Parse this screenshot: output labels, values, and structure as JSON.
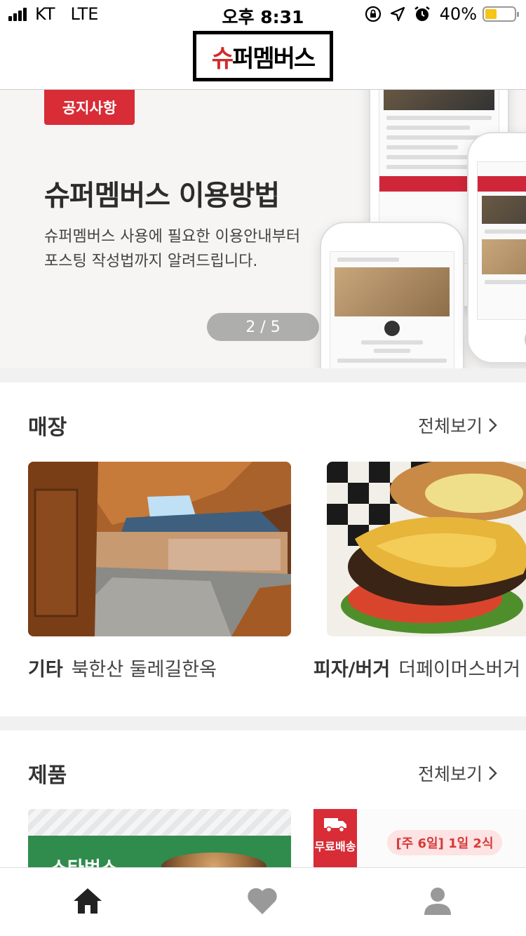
{
  "status_bar": {
    "carrier": "KT",
    "network": "LTE",
    "time": "오후 8:31",
    "battery_percent": "40%",
    "battery_level": 0.4,
    "icons": [
      "signal-icon",
      "orientation-lock-icon",
      "location-arrow-icon",
      "alarm-icon",
      "battery-icon"
    ]
  },
  "header": {
    "logo_first": "슈",
    "logo_rest": "퍼멤버스"
  },
  "banner": {
    "badge": "공지사항",
    "title": "슈퍼멤버스 이용방법",
    "description": "슈퍼멤버스 사용에 필요한 이용안내부터\n포스팅 작성법까지 알려드립니다.",
    "pager": "2 / 5"
  },
  "stores": {
    "title": "매장",
    "see_all": "전체보기",
    "items": [
      {
        "category": "기타",
        "name": "북한산 둘레길한옥"
      },
      {
        "category": "피자/버거",
        "name": "더페이머스버거"
      }
    ]
  },
  "products": {
    "title": "제품",
    "see_all": "전체보기",
    "items": [
      {
        "image_text": "스타벅스"
      },
      {
        "badge": "무료배송",
        "schedule": "[주 6일] 1일 2식"
      }
    ]
  },
  "tab_bar": {
    "tabs": [
      {
        "icon": "home-icon",
        "active": true
      },
      {
        "icon": "heart-icon",
        "active": false
      },
      {
        "icon": "profile-icon",
        "active": false
      }
    ]
  },
  "colors": {
    "accent_red": "#d82c36",
    "text_dark": "#333333",
    "tab_active": "#222222",
    "tab_inactive": "#999999"
  }
}
